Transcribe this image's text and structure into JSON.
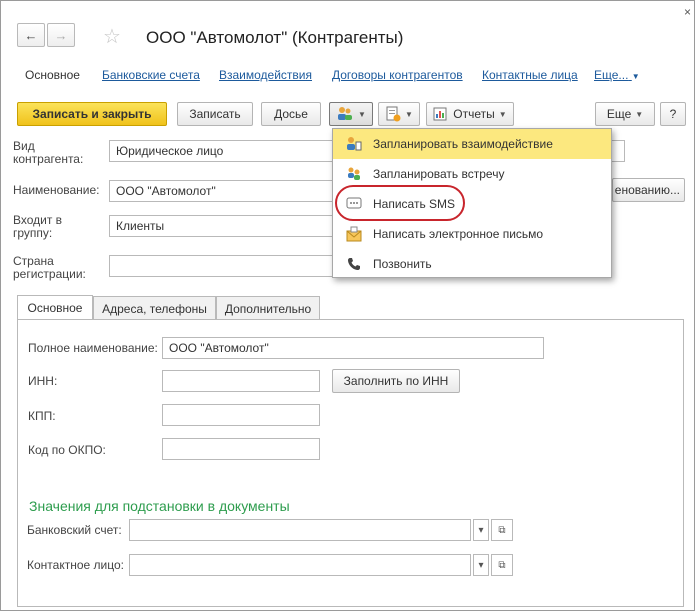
{
  "window": {
    "title": "ООО \"Автомолот\" (Контрагенты)",
    "close_glyph": "×",
    "back_glyph": "←",
    "forward_glyph": "→",
    "star_glyph": "☆"
  },
  "nav": {
    "items": [
      {
        "label": "Основное"
      },
      {
        "label": "Банковские счета"
      },
      {
        "label": "Взаимодействия"
      },
      {
        "label": "Договоры контрагентов"
      },
      {
        "label": "Контактные лица"
      },
      {
        "label": "Еще..."
      }
    ]
  },
  "toolbar": {
    "save_close_label": "Записать и закрыть",
    "save_label": "Записать",
    "dossier_label": "Досье",
    "reports_label": "Отчеты",
    "more_label": "Еще",
    "help_label": "?"
  },
  "form": {
    "vid_label": "Вид\nконтрагента:",
    "vid_value": "Юридическое лицо",
    "name_label": "Наименование:",
    "name_value": "ООО \"Автомолот\"",
    "name_side_btn": "енованию...",
    "group_label": "Входит в\nгруппу:",
    "group_value": "Клиенты",
    "country_label": "Страна\nрегистрации:",
    "country_value": ""
  },
  "tabs": [
    {
      "label": "Основное"
    },
    {
      "label": "Адреса, телефоны"
    },
    {
      "label": "Дополнительно"
    }
  ],
  "main_tab": {
    "full_name_label": "Полное наименование:",
    "full_name_value": "ООО \"Автомолот\"",
    "inn_label": "ИНН:",
    "inn_value": "",
    "fill_by_inn_label": "Заполнить по ИНН",
    "kpp_label": "КПП:",
    "kpp_value": "",
    "okpo_label": "Код по ОКПО:",
    "okpo_value": "",
    "section_title": "Значения для подстановки в документы",
    "bank_account_label": "Банковский счет:",
    "bank_account_value": "",
    "contact_label": "Контактное лицо:",
    "contact_value": ""
  },
  "dropdown": {
    "items": [
      {
        "label": "Запланировать взаимодействие",
        "icon": "interaction-icon",
        "highlighted": true
      },
      {
        "label": "Запланировать встречу",
        "icon": "meeting-icon"
      },
      {
        "label": "Написать SMS",
        "icon": "sms-icon",
        "circled": true
      },
      {
        "label": "Написать электронное письмо",
        "icon": "email-icon"
      },
      {
        "label": "Позвонить",
        "icon": "phone-icon"
      }
    ]
  },
  "colors": {
    "accent_yellow": "#f0c21b",
    "highlight": "#fce87f",
    "link": "#1d5a9c",
    "section_green": "#2e9d4e",
    "annotation_red": "#c8252c"
  }
}
